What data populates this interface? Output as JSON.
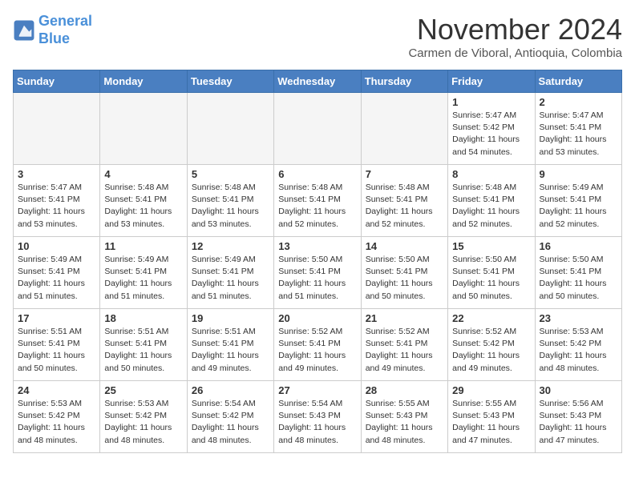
{
  "header": {
    "logo_line1": "General",
    "logo_line2": "Blue",
    "month": "November 2024",
    "location": "Carmen de Viboral, Antioquia, Colombia"
  },
  "weekdays": [
    "Sunday",
    "Monday",
    "Tuesday",
    "Wednesday",
    "Thursday",
    "Friday",
    "Saturday"
  ],
  "weeks": [
    [
      {
        "day": "",
        "info": ""
      },
      {
        "day": "",
        "info": ""
      },
      {
        "day": "",
        "info": ""
      },
      {
        "day": "",
        "info": ""
      },
      {
        "day": "",
        "info": ""
      },
      {
        "day": "1",
        "info": "Sunrise: 5:47 AM\nSunset: 5:42 PM\nDaylight: 11 hours\nand 54 minutes."
      },
      {
        "day": "2",
        "info": "Sunrise: 5:47 AM\nSunset: 5:41 PM\nDaylight: 11 hours\nand 53 minutes."
      }
    ],
    [
      {
        "day": "3",
        "info": "Sunrise: 5:47 AM\nSunset: 5:41 PM\nDaylight: 11 hours\nand 53 minutes."
      },
      {
        "day": "4",
        "info": "Sunrise: 5:48 AM\nSunset: 5:41 PM\nDaylight: 11 hours\nand 53 minutes."
      },
      {
        "day": "5",
        "info": "Sunrise: 5:48 AM\nSunset: 5:41 PM\nDaylight: 11 hours\nand 53 minutes."
      },
      {
        "day": "6",
        "info": "Sunrise: 5:48 AM\nSunset: 5:41 PM\nDaylight: 11 hours\nand 52 minutes."
      },
      {
        "day": "7",
        "info": "Sunrise: 5:48 AM\nSunset: 5:41 PM\nDaylight: 11 hours\nand 52 minutes."
      },
      {
        "day": "8",
        "info": "Sunrise: 5:48 AM\nSunset: 5:41 PM\nDaylight: 11 hours\nand 52 minutes."
      },
      {
        "day": "9",
        "info": "Sunrise: 5:49 AM\nSunset: 5:41 PM\nDaylight: 11 hours\nand 52 minutes."
      }
    ],
    [
      {
        "day": "10",
        "info": "Sunrise: 5:49 AM\nSunset: 5:41 PM\nDaylight: 11 hours\nand 51 minutes."
      },
      {
        "day": "11",
        "info": "Sunrise: 5:49 AM\nSunset: 5:41 PM\nDaylight: 11 hours\nand 51 minutes."
      },
      {
        "day": "12",
        "info": "Sunrise: 5:49 AM\nSunset: 5:41 PM\nDaylight: 11 hours\nand 51 minutes."
      },
      {
        "day": "13",
        "info": "Sunrise: 5:50 AM\nSunset: 5:41 PM\nDaylight: 11 hours\nand 51 minutes."
      },
      {
        "day": "14",
        "info": "Sunrise: 5:50 AM\nSunset: 5:41 PM\nDaylight: 11 hours\nand 50 minutes."
      },
      {
        "day": "15",
        "info": "Sunrise: 5:50 AM\nSunset: 5:41 PM\nDaylight: 11 hours\nand 50 minutes."
      },
      {
        "day": "16",
        "info": "Sunrise: 5:50 AM\nSunset: 5:41 PM\nDaylight: 11 hours\nand 50 minutes."
      }
    ],
    [
      {
        "day": "17",
        "info": "Sunrise: 5:51 AM\nSunset: 5:41 PM\nDaylight: 11 hours\nand 50 minutes."
      },
      {
        "day": "18",
        "info": "Sunrise: 5:51 AM\nSunset: 5:41 PM\nDaylight: 11 hours\nand 50 minutes."
      },
      {
        "day": "19",
        "info": "Sunrise: 5:51 AM\nSunset: 5:41 PM\nDaylight: 11 hours\nand 49 minutes."
      },
      {
        "day": "20",
        "info": "Sunrise: 5:52 AM\nSunset: 5:41 PM\nDaylight: 11 hours\nand 49 minutes."
      },
      {
        "day": "21",
        "info": "Sunrise: 5:52 AM\nSunset: 5:41 PM\nDaylight: 11 hours\nand 49 minutes."
      },
      {
        "day": "22",
        "info": "Sunrise: 5:52 AM\nSunset: 5:42 PM\nDaylight: 11 hours\nand 49 minutes."
      },
      {
        "day": "23",
        "info": "Sunrise: 5:53 AM\nSunset: 5:42 PM\nDaylight: 11 hours\nand 48 minutes."
      }
    ],
    [
      {
        "day": "24",
        "info": "Sunrise: 5:53 AM\nSunset: 5:42 PM\nDaylight: 11 hours\nand 48 minutes."
      },
      {
        "day": "25",
        "info": "Sunrise: 5:53 AM\nSunset: 5:42 PM\nDaylight: 11 hours\nand 48 minutes."
      },
      {
        "day": "26",
        "info": "Sunrise: 5:54 AM\nSunset: 5:42 PM\nDaylight: 11 hours\nand 48 minutes."
      },
      {
        "day": "27",
        "info": "Sunrise: 5:54 AM\nSunset: 5:43 PM\nDaylight: 11 hours\nand 48 minutes."
      },
      {
        "day": "28",
        "info": "Sunrise: 5:55 AM\nSunset: 5:43 PM\nDaylight: 11 hours\nand 48 minutes."
      },
      {
        "day": "29",
        "info": "Sunrise: 5:55 AM\nSunset: 5:43 PM\nDaylight: 11 hours\nand 47 minutes."
      },
      {
        "day": "30",
        "info": "Sunrise: 5:56 AM\nSunset: 5:43 PM\nDaylight: 11 hours\nand 47 minutes."
      }
    ]
  ]
}
